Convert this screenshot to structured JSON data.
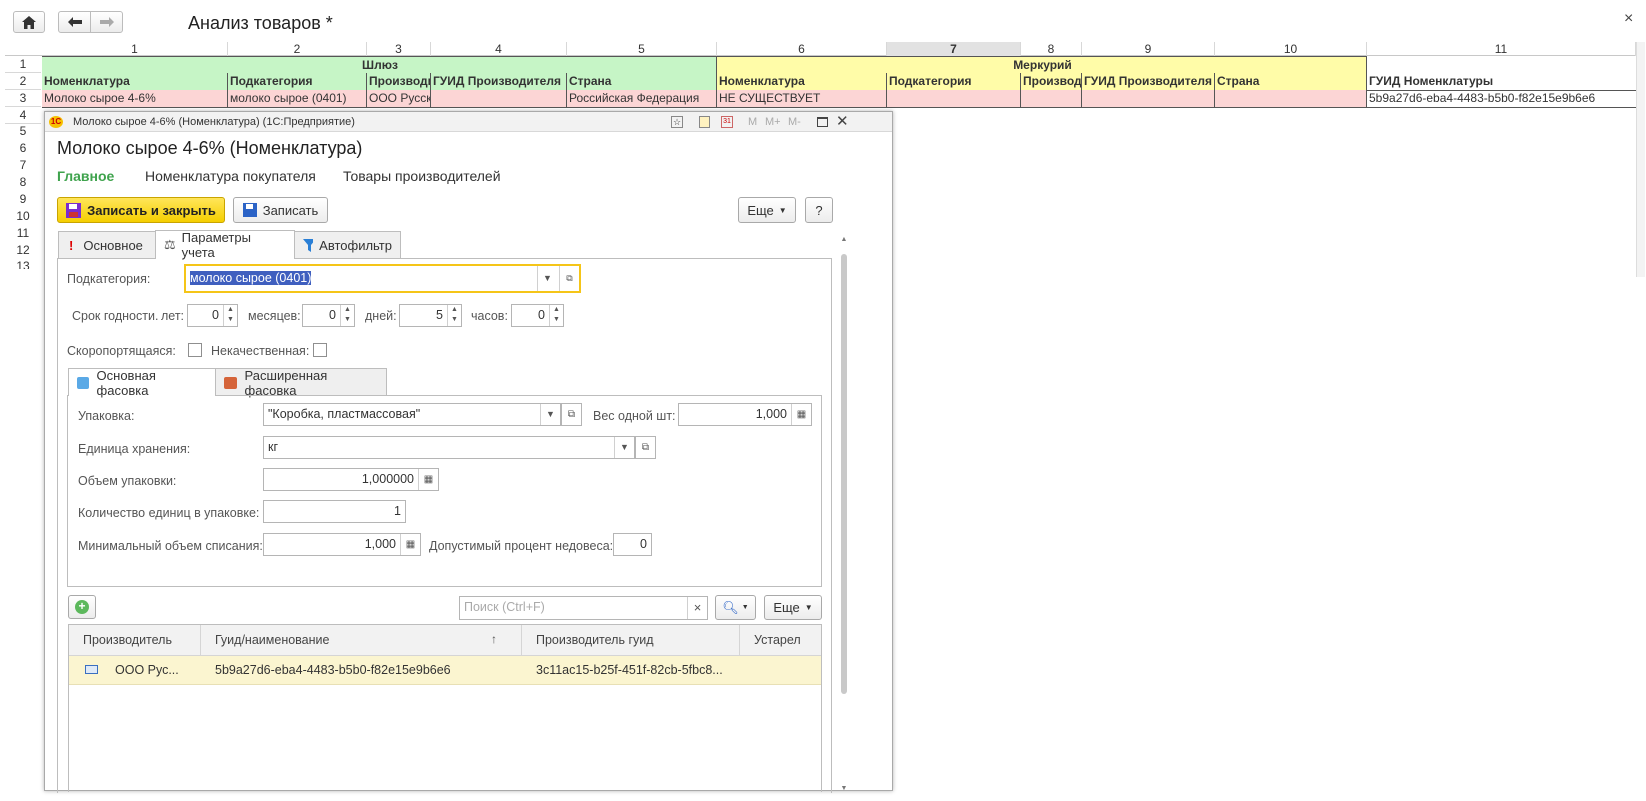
{
  "window": {
    "title": "Анализ товаров *",
    "close": "×"
  },
  "sheet": {
    "col_numbers": [
      "1",
      "2",
      "3",
      "4",
      "5",
      "6",
      "7",
      "8",
      "9",
      "10",
      "11"
    ],
    "row_numbers": [
      "1",
      "2",
      "3",
      "4",
      "5",
      "6",
      "7",
      "8",
      "9",
      "10",
      "11",
      "12",
      "13"
    ],
    "group_left": "Шлюз",
    "group_right": "Меркурий",
    "headers": [
      "Номенклатура",
      "Подкатегория",
      "Производитель",
      "ГУИД Производителя",
      "Страна",
      "Номенклатура",
      "Подкатегория",
      "Производитель",
      "ГУИД Производителя",
      "Страна",
      "ГУИД Номенклатуры"
    ],
    "row3": [
      "Молоко сырое 4-6%",
      "молоко сырое (0401)",
      "ООО Русское молоко",
      "",
      "Российская Федерация",
      "НЕ СУЩЕСТВУЕТ",
      "",
      "",
      "",
      "",
      "5b9a27d6-eba4-4483-b5b0-f82e15e9b6e6"
    ]
  },
  "dialog": {
    "window_title": "Молоко сырое 4-6% (Номенклатура)  (1С:Предприятие)",
    "title_buttons": [
      "M",
      "M+",
      "M-"
    ],
    "heading": "Молоко сырое 4-6% (Номенклатура)",
    "nav": [
      "Главное",
      "Номенклатура покупателя",
      "Товары производителей"
    ],
    "buttons": {
      "save_close": "Записать и закрыть",
      "save": "Записать",
      "more": "Еще",
      "help": "?"
    },
    "tabs": [
      "Основное",
      "Параметры учета",
      "Автофильтр"
    ],
    "subcategory": {
      "label": "Подкатегория:",
      "value": "молоко сырое (0401)"
    },
    "shelf_life": {
      "label": "Срок годности.",
      "years_label": "лет:",
      "years": "0",
      "months_label": "месяцев:",
      "months": "0",
      "days_label": "дней:",
      "days": "5",
      "hours_label": "часов:",
      "hours": "0"
    },
    "perishable_label": "Скоропортящаяся:",
    "low_quality_label": "Некачественная:",
    "pack_tabs": [
      "Основная фасовка",
      "Расширенная фасовка"
    ],
    "packaging": {
      "label": "Упаковка:",
      "value": "\"Коробка, пластмассовая\""
    },
    "weight_one": {
      "label": "Вес одной шт:",
      "value": "1,000"
    },
    "storage_unit": {
      "label": "Единица хранения:",
      "value": "кг"
    },
    "pack_volume": {
      "label": "Объем упаковки:",
      "value": "1,000000"
    },
    "units_in_pack": {
      "label": "Количество единиц в упаковке:",
      "value": "1"
    },
    "min_writeoff": {
      "label": "Минимальный объем списания:",
      "value": "1,000"
    },
    "allowed_underweight": {
      "label": "Допустимый процент недовеса:",
      "value": "0"
    },
    "search_placeholder": "Поиск (Ctrl+F)",
    "search_clear": "×",
    "grid": {
      "columns": [
        "Производитель",
        "Гуид/наименование",
        "Производитель гуид",
        "Устарел"
      ],
      "sort_arrow": "↑",
      "rows": [
        {
          "producer": "ООО Рус...",
          "guid": "5b9a27d6-eba4-4483-b5b0-f82e15e9b6e6",
          "producer_guid": "3c11ac15-b25f-451f-82cb-5fbc8...",
          "obsolete": ""
        }
      ]
    }
  }
}
